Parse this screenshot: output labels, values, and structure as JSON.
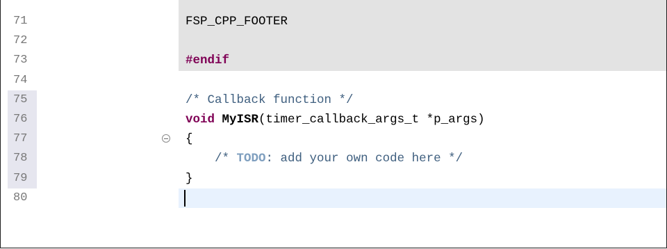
{
  "editor": {
    "line_numbers": [
      "71",
      "72",
      "73",
      "74",
      "75",
      "76",
      "77",
      "78",
      "79",
      "80"
    ],
    "lines": {
      "l71": "FSP_CPP_FOOTER",
      "l72": "",
      "l73_keyword": "#endif",
      "l74": "",
      "l75_comment": "/* Callback function */",
      "l76_type": "void",
      "l76_name": "MyISR",
      "l76_params": "(timer_callback_args_t *p_args)",
      "l77": "{",
      "l78_indent": "    ",
      "l78_open": "/* ",
      "l78_todo": "TODO",
      "l78_rest": ": add your own code here */",
      "l79": "}",
      "l80": ""
    },
    "colors": {
      "keyword": "#7f0055",
      "comment": "#3f5f7f",
      "todo_tag": "#7f9fbf",
      "disabled_block": "#e3e3e3",
      "current_line": "#e8f2fe",
      "line_number": "#787878"
    }
  }
}
